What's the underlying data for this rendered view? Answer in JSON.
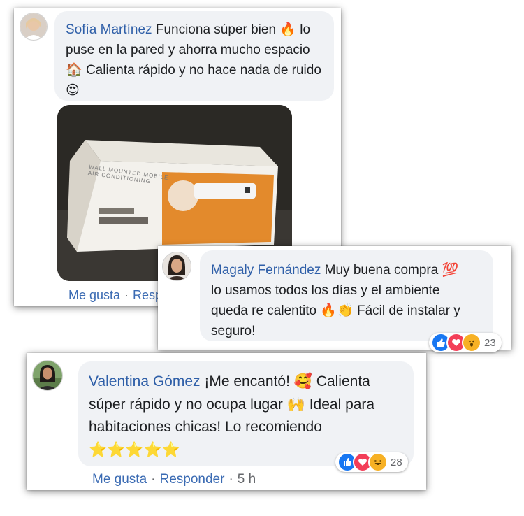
{
  "comments": [
    {
      "author": "Sofía Martínez",
      "text_line1": "Funciona súper bien",
      "emoji_fire": "🔥",
      "text_line1b": "lo",
      "text_line2": "puse en la pared y ahorra mucho espacio",
      "emoji_house": "🏠",
      "text_line3": "Calienta rápido y no hace nada de ruido",
      "emoji_heart_eyes": "😍",
      "photo": {
        "box_title": "WALL MOUNTED MOBILE",
        "box_subtitle": "AIR CONDITIONING"
      },
      "actions": {
        "like": "Me gusta",
        "reply": "Resp"
      }
    },
    {
      "author": "Magaly Fernández",
      "text_line1": "Muy buena compra",
      "emoji_100": "💯",
      "text_line2": "lo usamos todos los días y el ambiente",
      "text_line3a": "queda re calentito",
      "emoji_fire": "🔥",
      "emoji_clap": "👏",
      "text_line3b": "Fácil de instalar y",
      "text_line4": "seguro!",
      "reactions": {
        "count": "23",
        "icons": [
          "like-icon",
          "love-icon",
          "wow-icon"
        ]
      }
    },
    {
      "author": "Valentina Gómez",
      "text_line1": "¡Me encantó!",
      "emoji_love": "🥰",
      "text_line1b": "Calienta",
      "text_line2a": "súper rápido y no ocupa lugar",
      "emoji_hands": "🙌",
      "text_line2b": "Ideal para",
      "text_line3": "habitaciones chicas! Lo recomiendo",
      "stars": "⭐⭐⭐⭐⭐",
      "reactions": {
        "count": "28",
        "icons": [
          "like-icon",
          "love-icon",
          "haha-icon"
        ]
      },
      "actions": {
        "like": "Me gusta",
        "reply": "Responder",
        "time": "5 h"
      }
    }
  ],
  "colors": {
    "name": "#2f5fa8",
    "bubble": "#f0f2f5",
    "like": "#1877f2",
    "love": "#f33e58",
    "wow": "#f7b125"
  }
}
